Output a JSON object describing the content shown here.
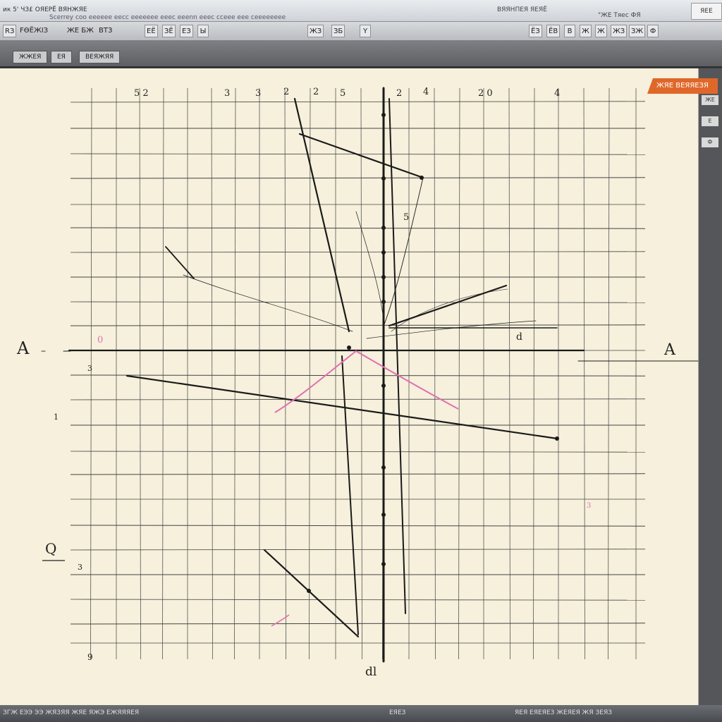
{
  "window": {
    "title_left": "ик 5' ЧЗ£ ОЯЕРЁ ВЯНЖЯЕ",
    "title_sub": "Scerrey coo eeeeee eecc eeeeeee eeec eeenn eeec cceee eee ceeeeeeee",
    "title_right": "ВЯЯНПЕЯ ЯЕЯЁ",
    "title_right2": "\"ЖЕ Тяес ФЯ",
    "logo": "ЯEE"
  },
  "toolbar": {
    "btn_left": "RЗ",
    "label_file": "FѲЁЖІЗ",
    "label_edit": "ЖЕ БЖ",
    "label_view": "ВТЗ",
    "btn_a": "ЕЁ",
    "btn_b": "ЗЁ",
    "btn_c": "ЕЗ",
    "btn_d": "Ы",
    "btn_e": "ЖЗ",
    "btn_f": "ЗБ",
    "btn_g": "Y",
    "right_btns": [
      "ЁЗ",
      "ЁВ",
      "В",
      "Ж",
      "Ж",
      "ЖЗ",
      "ЗЖ",
      "Ф"
    ]
  },
  "subtabs": [
    "ЖЖЕЯ",
    "ЕЯ",
    "ВЕЯЖЯЯ"
  ],
  "badge": "ЖЯЕ ВЕЯЯЕЗЯ",
  "rail_items": [
    "ЖЕ",
    "Е",
    "Ф"
  ],
  "status": {
    "left": "ЗГЖ  ЕЭЭ  ЭЭ  ЖЯЗЯЯ ЖЯЕ ЯЖЭ ЕЖЯЯЯЕЯ",
    "mid": "ЕЯЕЗ",
    "right": "ЯЕЯ  ЕЯЕЯЕЗ  ЖЕЯЕЯ ЖЯ  ЗЕЯЗ"
  },
  "plot_labels": {
    "A_left": "A",
    "A_right": "A",
    "Q": "Q",
    "bottom_center": "dl",
    "bottom_left": "9",
    "top_marks": [
      "5 2",
      "3",
      "3",
      "2",
      "2",
      "5",
      "2",
      "4",
      "2 0",
      "4"
    ],
    "mid_5": "5",
    "mid_right_d": "d",
    "pink_0": "0",
    "left_labels": [
      "3",
      "1",
      "3"
    ],
    "pink_right": "3"
  },
  "colors": {
    "paper": "#f6f0dc",
    "grid": "#555555",
    "ink": "#1a1a1a",
    "pink": "#e070b0",
    "accent": "#e0672a"
  }
}
